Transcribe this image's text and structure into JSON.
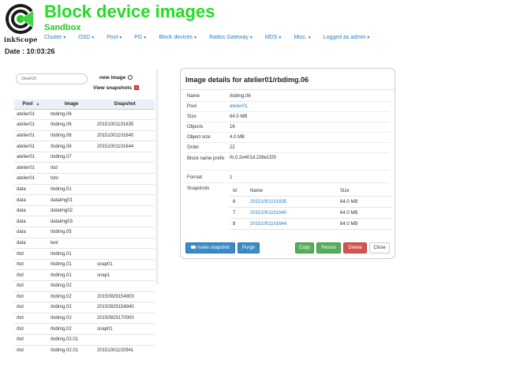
{
  "header": {
    "logo_text": "inkScope",
    "title": "Block device images",
    "subtitle": "Sandbox"
  },
  "nav": [
    {
      "label": "Cluster",
      "dropdown": true
    },
    {
      "label": "OSD",
      "dropdown": true
    },
    {
      "label": "Pool",
      "dropdown": true
    },
    {
      "label": "PG",
      "dropdown": true
    },
    {
      "label": "Block devices",
      "dropdown": true
    },
    {
      "label": "Rados Gateway",
      "dropdown": true
    },
    {
      "label": "MDS",
      "dropdown": true
    },
    {
      "label": "Misc.",
      "dropdown": true
    },
    {
      "label": "Logged as admin",
      "dropdown": true
    }
  ],
  "date": "Date : 10:03:26",
  "left_panel": {
    "search_placeholder": "Search",
    "new_image_label": "new image",
    "view_snapshots_label": "View snapshots",
    "view_snapshots_checked": true,
    "columns": [
      "Pool",
      "Image",
      "Snapshot"
    ],
    "rows": [
      [
        "atelier01",
        "rbdimg.06",
        ""
      ],
      [
        "atelier01",
        "rbdimg.06",
        "20151001101635"
      ],
      [
        "atelier01",
        "rbdimg.06",
        "20151001101640"
      ],
      [
        "atelier01",
        "rbdimg.06",
        "20151001101644"
      ],
      [
        "atelier01",
        "rbdimg.07",
        ""
      ],
      [
        "atelier01",
        "rbd",
        ""
      ],
      [
        "atelier01",
        "toto",
        ""
      ],
      [
        "data",
        "rbdimg.01",
        ""
      ],
      [
        "data",
        "dataimg01",
        ""
      ],
      [
        "data",
        "dataimg02",
        ""
      ],
      [
        "data",
        "dataimg03",
        ""
      ],
      [
        "data",
        "rbdimg.05",
        ""
      ],
      [
        "data",
        "test",
        ""
      ],
      [
        "rbd",
        "rbdimg.01",
        ""
      ],
      [
        "rbd",
        "rbdimg.01",
        "snap01"
      ],
      [
        "rbd",
        "rbdimg.01",
        "snap1"
      ],
      [
        "rbd",
        "rbdimg.02",
        ""
      ],
      [
        "rbd",
        "rbdimg.02",
        "20150929154803"
      ],
      [
        "rbd",
        "rbdimg.02",
        "20150929154840"
      ],
      [
        "rbd",
        "rbdimg.02",
        "20150929170000"
      ],
      [
        "rbd",
        "rbdimg.02",
        "snap01"
      ],
      [
        "rbd",
        "rbdimg.02.01",
        ""
      ],
      [
        "rbd",
        "rbdimg.02.01",
        "20151001102941"
      ]
    ]
  },
  "details": {
    "title": "Image details for atelier01/rbdimg.06",
    "props": [
      {
        "label": "Name",
        "value": "rbdimg.06",
        "link": false
      },
      {
        "label": "Pool",
        "value": "atelier01",
        "link": true
      },
      {
        "label": "Size",
        "value": "64.0 MB",
        "link": false
      },
      {
        "label": "Objects",
        "value": "16",
        "link": false
      },
      {
        "label": "Object size",
        "value": "4.0 MB",
        "link": false
      },
      {
        "label": "Order",
        "value": "22",
        "link": false
      }
    ],
    "prefix_label": "Block name prefix",
    "prefix_value": "rb.0.2e401d.238e1f29",
    "format_label": "Format",
    "format_value": "1",
    "snapshots_label": "Snapshots",
    "snapshot_columns": [
      "Id",
      "Name",
      "Size"
    ],
    "snapshots": [
      {
        "id": "6",
        "name": "20151001101635",
        "size": "64.0 MB"
      },
      {
        "id": "7",
        "name": "20151001101640",
        "size": "64.0 MB"
      },
      {
        "id": "8",
        "name": "20151001101644",
        "size": "64.0 MB"
      }
    ],
    "buttons": {
      "make_snapshot": "make snapshot",
      "purge": "Purge",
      "copy": "Copy",
      "resize": "Resize",
      "delete": "Delete",
      "close": "Close"
    }
  },
  "colors": {
    "title_green": "#22dd22",
    "link_blue": "#2a7fc0",
    "primary": "#3a8bc7",
    "success": "#56ae58",
    "danger": "#d5534f"
  }
}
